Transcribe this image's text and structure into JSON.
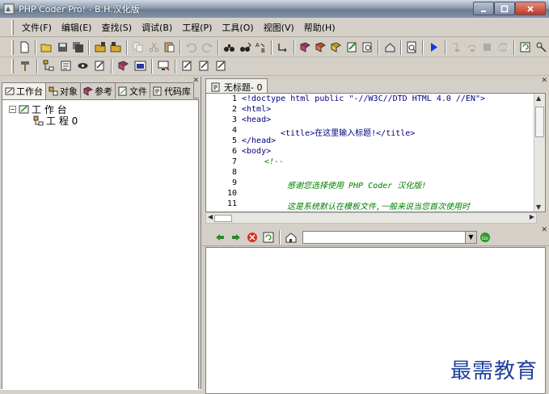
{
  "window": {
    "title": "PHP Coder Pro! - B.H.汉化版"
  },
  "menu": [
    "文件(F)",
    "编辑(E)",
    "查找(S)",
    "调试(B)",
    "工程(P)",
    "工具(O)",
    "视图(V)",
    "帮助(H)"
  ],
  "left_tabs": [
    "工作台",
    "对象",
    "参考",
    "文件",
    "代码库"
  ],
  "tree": {
    "root": "工 作 台",
    "child": "工 程  0"
  },
  "editor": {
    "tab": "无标题- 0",
    "line_numbers": [
      "1",
      "2",
      "3",
      "4",
      "5",
      "6",
      "7",
      "8",
      "9",
      "10",
      "11"
    ],
    "lines": [
      "<!doctype html public \"-//W3C//DTD HTML 4.0 //EN\">",
      "<html>",
      "<head>",
      "<title>在这里输入标题!</title>",
      "</head>",
      "<body>",
      "<!--",
      "",
      "感谢您选择使用 PHP Coder 汉化版!",
      "",
      "这是系统默认在模板文件,一般来说当您首次使用时"
    ]
  },
  "watermark": "最需教育",
  "colors": {
    "tag": "#000080",
    "comment": "#008000",
    "watermark": "#1f3f9a"
  }
}
